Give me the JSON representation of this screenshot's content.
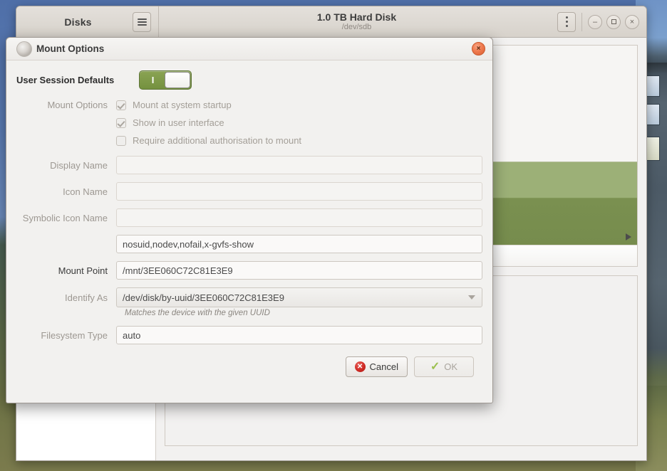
{
  "app_window": {
    "left_title": "Disks",
    "menu_icon": "hamburger-menu-icon",
    "device_title": "1.0 TB Hard Disk",
    "device_subtitle": "/dev/sdb",
    "kebab_icon": "vertical-dots-icon",
    "minimize_label": "–",
    "maximize_label": "",
    "close_label": "×"
  },
  "dialog": {
    "title": "Mount Options",
    "icon": "disk-icon",
    "close_label": "×",
    "user_session_defaults": {
      "label": "User Session Defaults",
      "state": "on",
      "on_marker": "I"
    },
    "mount_options_label": "Mount Options",
    "checkboxes": [
      {
        "label": "Mount at system startup",
        "checked": true,
        "enabled": false
      },
      {
        "label": "Show in user interface",
        "checked": true,
        "enabled": false
      },
      {
        "label": "Require additional authorisation to mount",
        "checked": false,
        "enabled": false
      }
    ],
    "fields": [
      {
        "label": "Display Name",
        "value": "",
        "placeholder": "",
        "enabled": false
      },
      {
        "label": "Icon Name",
        "value": "",
        "placeholder": "",
        "enabled": false
      },
      {
        "label": "Symbolic Icon Name",
        "value": "",
        "placeholder": "",
        "enabled": false
      }
    ],
    "options_field": {
      "label": "",
      "value": "nosuid,nodev,nofail,x-gvfs-show"
    },
    "mount_point": {
      "label": "Mount Point",
      "value": "/mnt/3EE060C72C81E3E9"
    },
    "identify_as": {
      "label": "Identify As",
      "value": "/dev/disk/by-uuid/3EE060C72C81E3E9",
      "hint": "Matches the device with the given UUID",
      "arrow_icon": "chevron-down-icon"
    },
    "filesystem_type": {
      "label": "Filesystem Type",
      "value": "auto"
    },
    "buttons": {
      "cancel": {
        "label": "Cancel",
        "icon": "error-circle-icon",
        "enabled": true
      },
      "ok": {
        "label": "OK",
        "icon": "check-icon",
        "enabled": false
      }
    }
  },
  "colors": {
    "toggle_on": "#7d9945",
    "volume_selected": "#7a9050",
    "close_button": "#ef7a4e",
    "cancel_icon": "#cf2a24",
    "ok_icon": "#9cc04f"
  }
}
